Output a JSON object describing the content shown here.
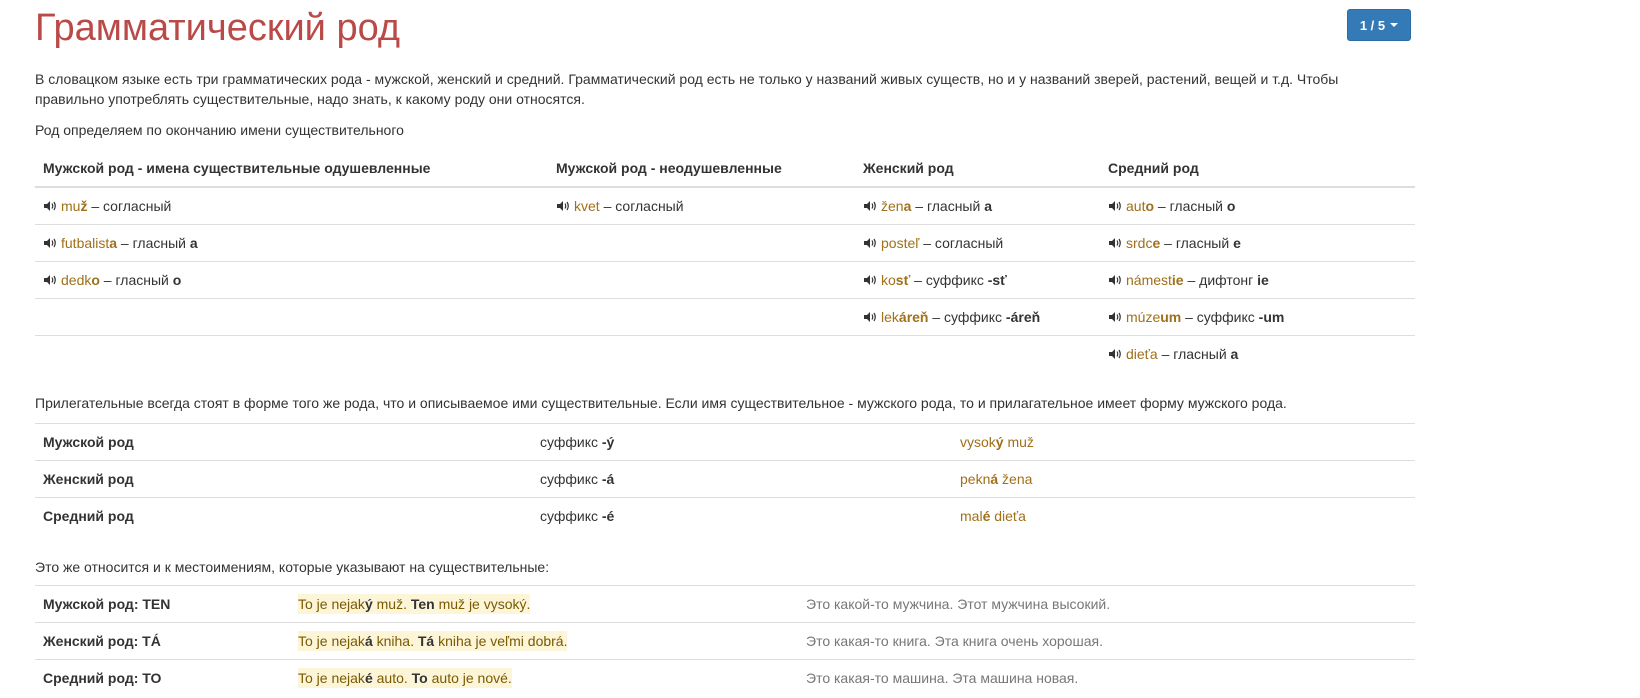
{
  "title": "Грамматический род",
  "pager": {
    "label": "1 / 5"
  },
  "intro": "В словацком языке есть три грамматических рода - мужской, женский и средний. Грамматический род есть не только у названий живых существ, но и у названий зверей, растений, вещей и т.д. Чтобы правильно употреблять существительные, надо знать, к какому роду они относятся.",
  "rule": "Род определяем по окончанию имени существительного",
  "gender_table": {
    "headers": [
      "Мужской род - имена существительные одушевленные",
      "Мужской род - неодушевленные",
      "Женский род",
      "Средний род"
    ],
    "rows": [
      [
        {
          "stem": "mu",
          "ending": "ž",
          "desc": " – согласный",
          "mark": ""
        },
        {
          "stem": "kvet",
          "ending": "",
          "desc": " – согласный",
          "mark": ""
        },
        {
          "stem": "žen",
          "ending": "a",
          "desc": " – гласный ",
          "mark": "a"
        },
        {
          "stem": "aut",
          "ending": "o",
          "desc": " – гласный ",
          "mark": "o"
        }
      ],
      [
        {
          "stem": "futbalist",
          "ending": "a",
          "desc": " – гласный ",
          "mark": "a"
        },
        null,
        {
          "stem": "posteľ",
          "ending": "",
          "desc": " – согласный",
          "mark": ""
        },
        {
          "stem": "srdc",
          "ending": "e",
          "desc": " – гласный ",
          "mark": "e"
        }
      ],
      [
        {
          "stem": "dedk",
          "ending": "o",
          "desc": " – гласный ",
          "mark": "o"
        },
        null,
        {
          "stem": "ko",
          "ending": "sť",
          "desc": " – суффикс ",
          "mark": "-sť"
        },
        {
          "stem": "námest",
          "ending": "ie",
          "desc": " – дифтонг ",
          "mark": "ie"
        }
      ],
      [
        null,
        null,
        {
          "stem": "lek",
          "ending": "áreň",
          "desc": " – суффикс ",
          "mark": "-áreň"
        },
        {
          "stem": "múze",
          "ending": "um",
          "desc": " – суффикс ",
          "mark": "-um"
        }
      ],
      [
        null,
        null,
        null,
        {
          "stem": "dieťa",
          "ending": "",
          "desc": " – гласный ",
          "mark": "a"
        }
      ]
    ]
  },
  "adjective_note": "Прилегательные всегда стоят в форме того же рода, что и описываемое ими существительные. Если имя существительное - мужского рода, то и прилагательное имеет форму мужского рода.",
  "adjective_table": [
    {
      "gender": "Мужской род",
      "suffix_text": "суффикс ",
      "suffix": "-ý",
      "ex_stem": "vysok",
      "ex_end": "ý",
      "ex_rest": " muž"
    },
    {
      "gender": "Женский род",
      "suffix_text": "суффикс ",
      "suffix": "-á",
      "ex_stem": "pekn",
      "ex_end": "á",
      "ex_rest": " žena"
    },
    {
      "gender": "Средний род",
      "suffix_text": "суффикс ",
      "suffix": "-é",
      "ex_stem": "mal",
      "ex_end": "é",
      "ex_rest": " dieťa"
    }
  ],
  "pronoun_note": "Это же относится и к местоимениям, которые указывают на существительные:",
  "pronoun_table": [
    {
      "gender": "Мужской род: TEN",
      "s1": "To je nejak",
      "s1e": "ý",
      "s2": " muž. ",
      "pron": "Ten",
      "s3": " muž je vysoký.",
      "translation": "Это какой-то мужчина. Этот мужчина высокий."
    },
    {
      "gender": "Женский род: TÁ",
      "s1": "To je nejak",
      "s1e": "á",
      "s2": " kniha. ",
      "pron": "Tá",
      "s3": " kniha je veľmi dobrá.",
      "translation": "Это какая-то книга. Эта книга очень хорошая."
    },
    {
      "gender": "Средний род: TO",
      "s1": "To je nejak",
      "s1e": "é",
      "s2": " auto. ",
      "pron": "To",
      "s3": " auto je nové.",
      "translation": "Это какая-то машина. Эта машина новая."
    }
  ],
  "icons": {
    "audio": "speaker-icon",
    "dropdown": "caret-down-icon"
  },
  "colors": {
    "title": "#b94a48",
    "button": "#337ab7",
    "word": "#a0701a",
    "highlight": "#fdf5d8"
  }
}
